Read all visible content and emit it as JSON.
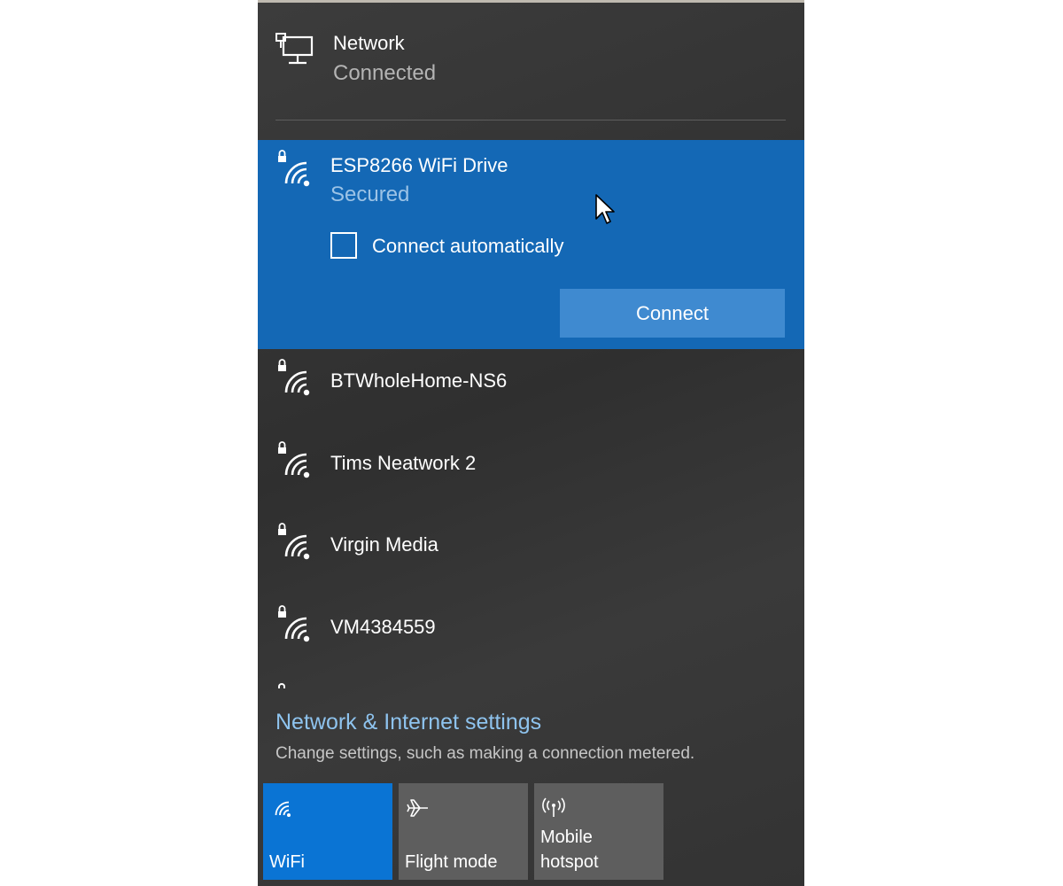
{
  "wired": {
    "icon": "wired-network-icon",
    "title": "Network",
    "status": "Connected"
  },
  "selected_network": {
    "icon": "secured-wifi-icon",
    "name": "ESP8266 WiFi Drive",
    "status": "Secured",
    "connect_auto_label": "Connect automatically",
    "connect_auto_checked": false,
    "connect_button": "Connect"
  },
  "networks": [
    {
      "name": "BTWholeHome-NS6",
      "icon": "secured-wifi-icon"
    },
    {
      "name": "Tims Neatwork 2",
      "icon": "secured-wifi-icon"
    },
    {
      "name": "Virgin Media",
      "icon": "secured-wifi-icon"
    },
    {
      "name": "VM4384559",
      "icon": "secured-wifi-icon"
    }
  ],
  "settings": {
    "link": "Network & Internet settings",
    "description": "Change settings, such as making a connection metered."
  },
  "quick_actions": [
    {
      "label": "WiFi",
      "icon": "wifi-icon",
      "active": true
    },
    {
      "label": "Flight mode",
      "icon": "airplane-icon",
      "active": false
    },
    {
      "label": "Mobile\nhotspot",
      "icon": "hotspot-icon",
      "active": false
    }
  ],
  "colors": {
    "panel_bg": "#333333",
    "selected_bg": "#1468b5",
    "connect_button": "#3f8ad0",
    "active_tile": "#0a74d4",
    "inactive_tile": "#5e5e5e",
    "link": "#8ec3ee"
  }
}
